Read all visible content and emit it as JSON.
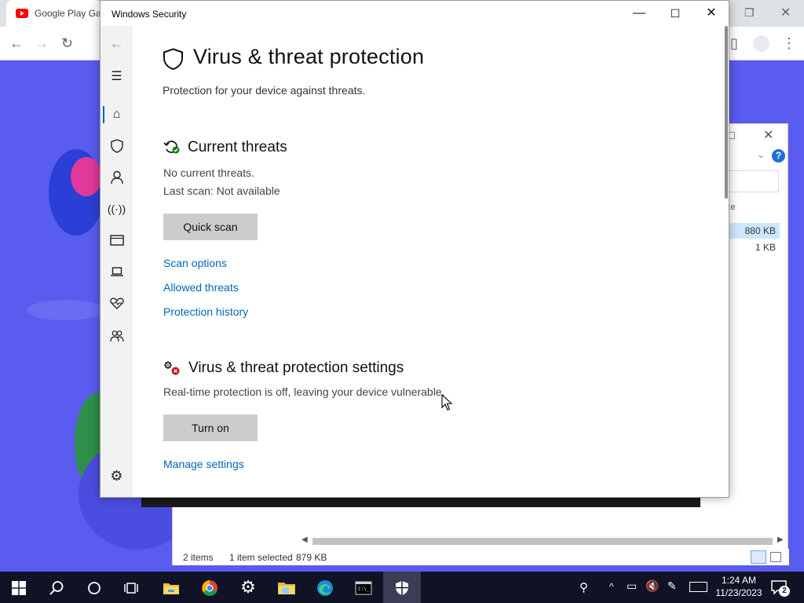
{
  "background": {
    "browser": {
      "tab_title": "Google Play Ga",
      "icons": [
        "back-icon",
        "forward-icon",
        "reload-icon",
        "sidebar-icon",
        "profile-icon",
        "menu-icon"
      ]
    },
    "explorer": {
      "column_header": "ze",
      "rows": [
        {
          "size": "880 KB"
        },
        {
          "size": "1 KB"
        }
      ],
      "status": {
        "items": "2 items",
        "selected": "1 item selected",
        "size": "879 KB"
      }
    }
  },
  "window": {
    "title": "Windows Security",
    "controls": {
      "minimize": "—",
      "maximize": "☐",
      "close": "✕"
    },
    "page": {
      "title": "Virus & threat protection",
      "subtitle": "Protection for your device against threats."
    },
    "current_threats": {
      "heading": "Current threats",
      "line1": "No current threats.",
      "line2": "Last scan: Not available",
      "button": "Quick scan",
      "links": [
        "Scan options",
        "Allowed threats",
        "Protection history"
      ]
    },
    "settings_section": {
      "heading": "Virus & threat protection settings",
      "text": "Real-time protection is off, leaving your device vulnerable.",
      "button": "Turn on",
      "link": "Manage settings"
    },
    "nav": [
      "back-icon",
      "menu-icon",
      "home-icon",
      "shield-icon",
      "account-icon",
      "wifi-icon",
      "browser-icon",
      "device-icon",
      "health-icon",
      "family-icon",
      "settings-icon"
    ],
    "accent": "#0067b8"
  },
  "taskbar": {
    "apps": [
      "start-icon",
      "search-icon",
      "cortana-icon",
      "task-view-icon",
      "file-explorer-icon",
      "chrome-icon",
      "settings-icon",
      "folder-icon",
      "edge-icon",
      "terminal-icon",
      "windows-security-icon"
    ],
    "clock": {
      "time": "1:24 AM",
      "date": "11/23/2023"
    },
    "notification_count": "2"
  }
}
